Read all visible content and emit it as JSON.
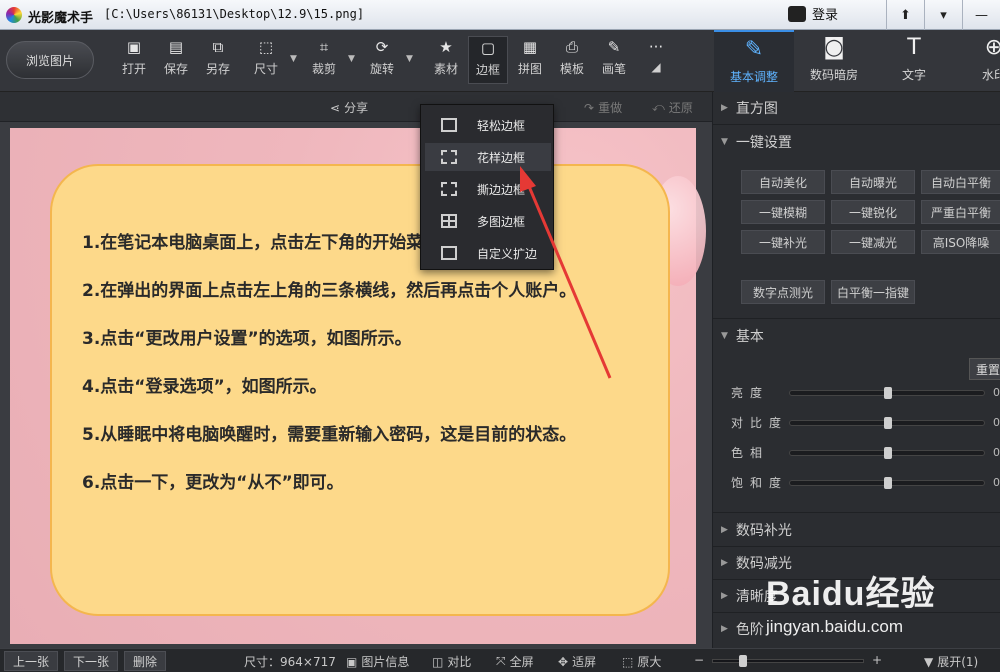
{
  "titlebar": {
    "app_name": "光影魔术手",
    "file_path": "[C:\\Users\\86131\\Desktop\\12.9\\15.png]",
    "login_label": "登录",
    "window_buttons": [
      "⬆",
      "▾",
      "—"
    ]
  },
  "toolbar": {
    "browse_label": "浏览图片",
    "tools": [
      {
        "label": "打开",
        "icon": "open-icon",
        "glyph": "▣"
      },
      {
        "label": "保存",
        "icon": "save-icon",
        "glyph": "▤"
      },
      {
        "label": "另存",
        "icon": "save-as-icon",
        "glyph": "⧉"
      },
      {
        "label": "尺寸",
        "icon": "resize-icon",
        "glyph": "⬚"
      },
      {
        "label": "裁剪",
        "icon": "crop-icon",
        "glyph": "⌗"
      },
      {
        "label": "旋转",
        "icon": "rotate-icon",
        "glyph": "⟳"
      },
      {
        "label": "素材",
        "icon": "material-icon",
        "glyph": "★"
      },
      {
        "label": "边框",
        "icon": "border-icon",
        "glyph": "▢"
      },
      {
        "label": "拼图",
        "icon": "collage-icon",
        "glyph": "▦"
      },
      {
        "label": "模板",
        "icon": "template-icon",
        "glyph": "⎙"
      },
      {
        "label": "画笔",
        "icon": "brush-icon",
        "glyph": "✎"
      },
      {
        "label": "···",
        "icon": "more-icon",
        "glyph": ""
      }
    ]
  },
  "subbar": {
    "share": "分享",
    "redo": "重做",
    "restore": "还原"
  },
  "border_menu": {
    "items": [
      "轻松边框",
      "花样边框",
      "撕边边框",
      "多图边框",
      "自定义扩边"
    ]
  },
  "image_text": {
    "steps": [
      "1.在笔记本电脑桌面上，点击左下角的开始菜单，如图所示。",
      "2.在弹出的界面上点击左上角的三条横线，然后再点击个人账户。",
      "3.点击“更改用户设置”的选项，如图所示。",
      "4.点击“登录选项”，如图所示。",
      "5.从睡眠中将电脑唤醒时，需要重新输入密码，这是目前的状态。",
      "6.点击一下，更改为“从不”即可。"
    ]
  },
  "right_tabs": [
    {
      "label": "基本调整",
      "glyph": "✎"
    },
    {
      "label": "数码暗房",
      "glyph": "◙"
    },
    {
      "label": "文字",
      "glyph": "T"
    },
    {
      "label": "水印",
      "glyph": "⊕"
    }
  ],
  "right_panel": {
    "histogram": "直方图",
    "one_click": "一键设置",
    "presets": [
      "自动美化",
      "自动曝光",
      "自动白平衡",
      "一键模糊",
      "一键锐化",
      "严重白平衡",
      "一键补光",
      "一键减光",
      "高ISO降噪",
      "数字点测光",
      "白平衡一指键"
    ],
    "basic": "基本",
    "reset": "重置",
    "sliders": [
      {
        "label": "亮度",
        "value": 0,
        "display": "0"
      },
      {
        "label": "对比度",
        "value": 0,
        "display": "0"
      },
      {
        "label": "色相",
        "value": 0,
        "display": "0"
      },
      {
        "label": "饱和度",
        "value": 0,
        "display": "0"
      }
    ],
    "collapsed_sections": [
      "数码补光",
      "数码减光",
      "清晰度",
      "色阶"
    ]
  },
  "statusbar": {
    "prev": "上一张",
    "next": "下一张",
    "delete": "删除",
    "size": "尺寸：964×717",
    "info": "图片信息",
    "compare": "对比",
    "fullscreen": "全屏",
    "fit": "适屏",
    "original": "原大",
    "zoom_minus": "−",
    "zoom_plus": "+",
    "expand": "展开(1)"
  },
  "watermark": {
    "brand": "Baidu经验",
    "url": "jingyan.baidu.com"
  },
  "colors": {
    "accent": "#3a8ee6",
    "card": "#fdd98a",
    "arrow": "#e53935"
  }
}
